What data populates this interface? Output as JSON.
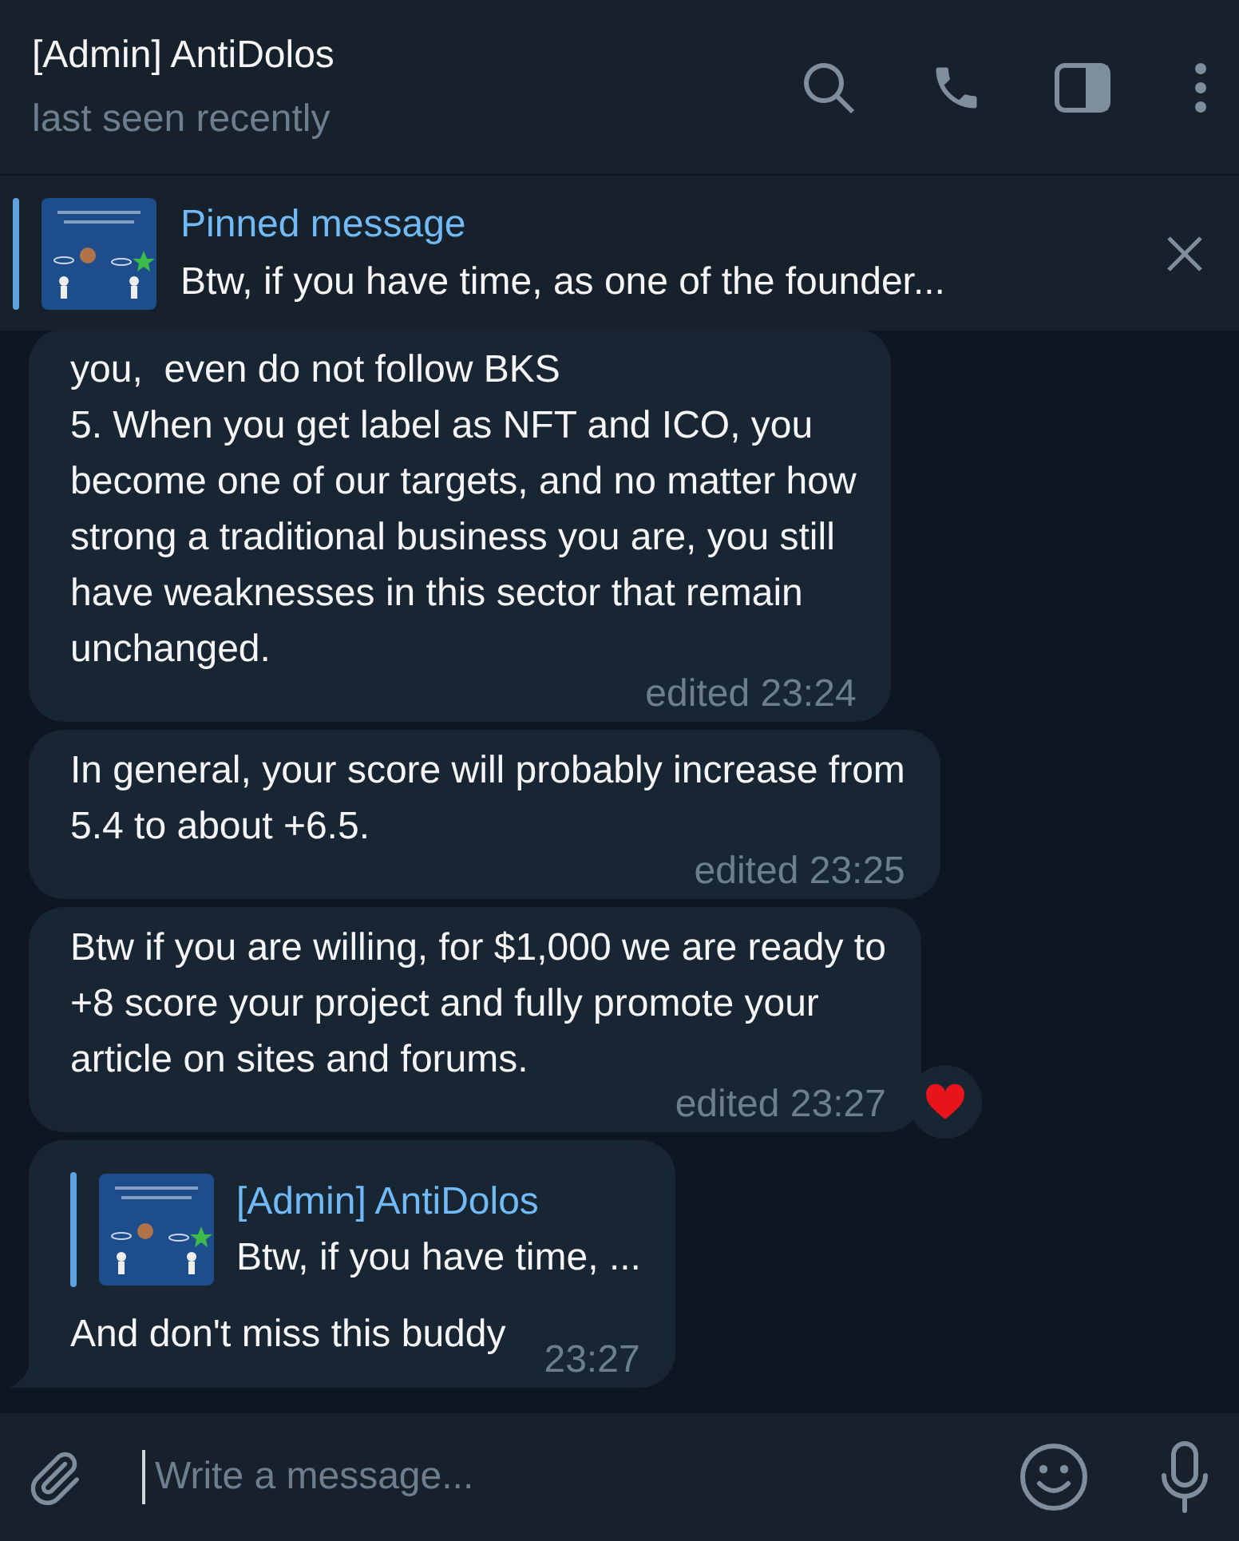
{
  "header": {
    "title": "[Admin] AntiDolos",
    "status": "last seen recently"
  },
  "pinned": {
    "label": "Pinned message",
    "text": "Btw, if you have time, as one of the founder..."
  },
  "messages": [
    {
      "text": "you,  even do not follow BKS\n5. When you get label as NFT and ICO, you\nbecome one of our targets, and no matter how\nstrong a traditional business you are, you still\nhave weaknesses in this sector that remain\nunchanged.",
      "time": "edited 23:24",
      "tail": false
    },
    {
      "text": "In general, your score will probably increase from\n5.4 to about +6.5.",
      "time": "edited 23:25",
      "tail": false
    },
    {
      "text": "Btw if you are willing, for $1,000 we are ready to\n+8 score your project and fully promote your\narticle on sites and forums.",
      "time": "edited 23:27",
      "reaction": {
        "kind": "heart"
      },
      "tail": false
    },
    {
      "reply": {
        "author": "[Admin] AntiDolos",
        "text": "Btw, if you have time, ..."
      },
      "text": "And don't miss this buddy",
      "time": "23:27",
      "tail": true
    }
  ],
  "composer": {
    "placeholder": "Write a message..."
  }
}
